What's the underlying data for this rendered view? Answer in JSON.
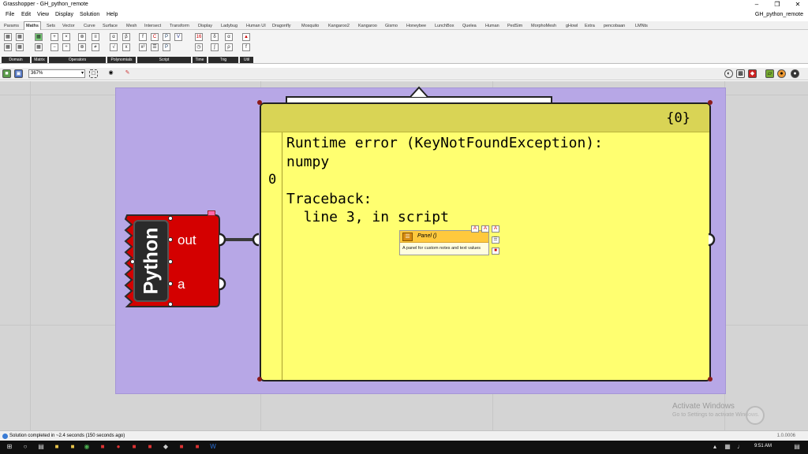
{
  "window": {
    "title": "Grasshopper - GH_python_remote",
    "doc_name": "GH_python_remote"
  },
  "menu": [
    "File",
    "Edit",
    "View",
    "Display",
    "Solution",
    "Help"
  ],
  "tabs": [
    "Params",
    "Maths",
    "Sets",
    "Vector",
    "Curve",
    "Surface",
    "Mesh",
    "Intersect",
    "Transform",
    "Display",
    "Ladybug",
    "Human UI",
    "Dragonfly",
    "Mosquito",
    "Kangaroo2",
    "Kangaroo",
    "Gismo",
    "Honeybee",
    "LunchBox",
    "Quelea",
    "Human",
    "PedSim",
    "MorphoMesh",
    "gHowl",
    "Extra",
    "pencobaan",
    "LMNts"
  ],
  "active_tab": "Maths",
  "ribbon_groups": [
    "Domain",
    "Matrix",
    "Operators",
    "Polynomials",
    "Script",
    "Time",
    "Trig",
    "Util"
  ],
  "zoom": "367%",
  "component": {
    "name": "Python",
    "output": "out",
    "input": "a"
  },
  "panel": {
    "index": "{0}",
    "line_number": "0",
    "text": "Runtime error (KeyNotFoundException):\nnumpy\n\nTraceback:\n  line 3, in script"
  },
  "tooltip": {
    "title": "Panel ()",
    "description": "A panel for custom notes and text values"
  },
  "watermark": {
    "line1": "Activate Windows",
    "line2": "Go to Settings to activate Windows."
  },
  "status": {
    "message": "Solution completed in ~2.4 seconds (150 seconds ago)",
    "version": "1.0.0006"
  },
  "clock": "9:51 AM",
  "colors": {
    "group": "#b7a7e6",
    "panel": "#ffff70",
    "component": "#d40000"
  }
}
